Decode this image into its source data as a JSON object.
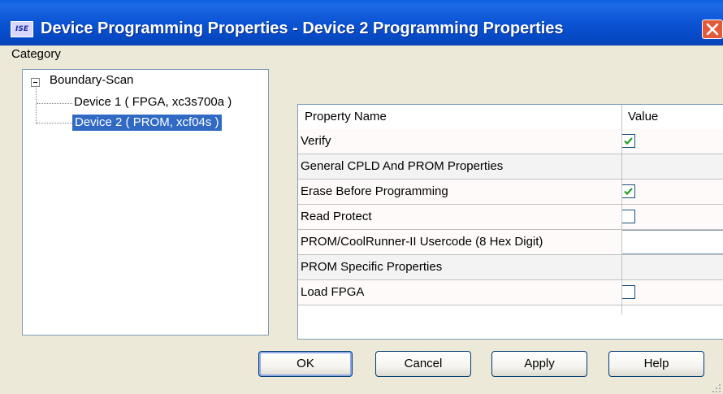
{
  "window": {
    "title": "Device Programming Properties - Device 2 Programming Properties",
    "icon_text": "ISE"
  },
  "category": {
    "label": "Category",
    "tree": {
      "root": "Boundary-Scan",
      "items": [
        {
          "label": "Device 1 ( FPGA, xc3s700a )",
          "selected": false
        },
        {
          "label": "Device 2 ( PROM, xcf04s )",
          "selected": true
        }
      ]
    }
  },
  "properties": {
    "headers": {
      "name": "Property Name",
      "value": "Value"
    },
    "rows": [
      {
        "name": "Verify",
        "type": "checkbox",
        "checked": true
      },
      {
        "name": "General CPLD And PROM Properties",
        "type": "group"
      },
      {
        "name": "Erase Before Programming",
        "type": "checkbox",
        "checked": true
      },
      {
        "name": "Read Protect",
        "type": "checkbox",
        "checked": false
      },
      {
        "name": "PROM/CoolRunner-II Usercode (8 Hex Digit)",
        "type": "text",
        "value": ""
      },
      {
        "name": "PROM Specific Properties",
        "type": "group"
      },
      {
        "name": "Load FPGA",
        "type": "checkbox",
        "checked": false
      }
    ]
  },
  "buttons": {
    "ok": "OK",
    "cancel": "Cancel",
    "apply": "Apply",
    "help": "Help"
  },
  "colors": {
    "title_bar": "#0b54d4",
    "selection": "#316ac5",
    "window_bg": "#ece9d8",
    "check_mark": "#21a121"
  }
}
